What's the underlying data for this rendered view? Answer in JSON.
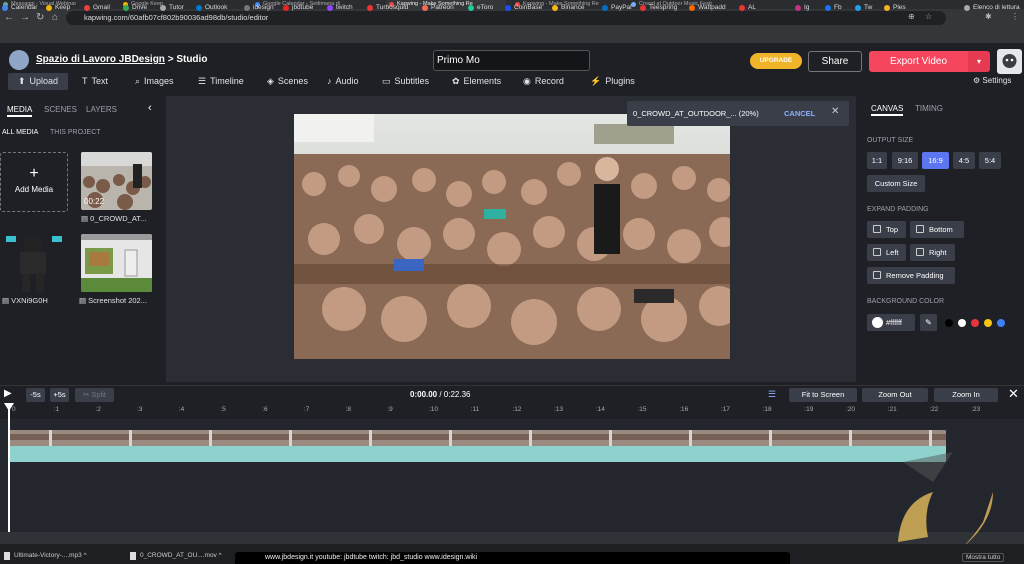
{
  "browser": {
    "tabs": [
      "Messaggi - Visual Webinar",
      "Google Keep",
      "Google Calendar - Settimana di",
      "Kapwing - Make Something Re",
      "Kapwing - Make Something Re",
      "Crowd at Outdoor Music Festi"
    ],
    "url": "kapwing.com/60afb07cf802b90036ad98db/studio/editor",
    "bookmarks": [
      "Calendar",
      "Keep",
      "Gmail",
      "Drive",
      "Tutor",
      "Outlook",
      "idesign",
      "jbdtube",
      "twitch",
      "Turbosquid",
      "Patreon",
      "eToro",
      "CoinBase",
      "Binance",
      "PayPal",
      "Teespring",
      "Wattpadd",
      "AL",
      "Ig",
      "Fb",
      "Tw",
      "Ples"
    ],
    "reading_list": "Elenco di lettura"
  },
  "header": {
    "workspace": "Spazio di Lavoro JBDesign",
    "separator": " > ",
    "studio": "Studio",
    "title_value": "Primo Mo",
    "upgrade": "UPGRADE",
    "share": "Share",
    "export": "Export Video",
    "settings": "Settings"
  },
  "toolbar": {
    "items": [
      "Upload",
      "Text",
      "Images",
      "Timeline",
      "Scenes",
      "Audio",
      "Subtitles",
      "Elements",
      "Record",
      "Plugins"
    ]
  },
  "left": {
    "tabs": [
      "MEDIA",
      "SCENES",
      "LAYERS"
    ],
    "subtabs": [
      "ALL MEDIA",
      "THIS PROJECT"
    ],
    "add_media": "Add Media",
    "media": [
      {
        "label": "0_CROWD_AT...",
        "duration": "00:22"
      },
      {
        "label": "VXNi9G0H"
      },
      {
        "label": "Screenshot 202..."
      }
    ]
  },
  "toast": {
    "text": "0_CROWD_AT_OUTDOOR_... (20%)",
    "cancel": "CANCEL"
  },
  "right": {
    "tabs": [
      "CANVAS",
      "TIMING"
    ],
    "output_size": "OUTPUT SIZE",
    "ratios": [
      "1:1",
      "9:16",
      "16:9",
      "4:5",
      "5:4"
    ],
    "selected_ratio": "16:9",
    "custom_size": "Custom Size",
    "expand_padding": "EXPAND PADDING",
    "padding": [
      "Top",
      "Bottom",
      "Left",
      "Right"
    ],
    "remove_padding": "Remove Padding",
    "background_color": "BACKGROUND COLOR",
    "bg_value": "#ffffff",
    "swatches": [
      "#000000",
      "#ffffff",
      "#e8343c",
      "#f5c518",
      "#3b82f6"
    ]
  },
  "timeline": {
    "back": "-5s",
    "forward": "+5s",
    "split": "Split",
    "current": "0:00.00",
    "total": " / 0:22.36",
    "fit": "Fit to Screen",
    "zoom_out": "Zoom Out",
    "zoom_in": "Zoom In",
    "ticks": [
      "0",
      ":1",
      ":2",
      ":3",
      ":4",
      ":5",
      ":6",
      ":7",
      ":8",
      ":9",
      ":10",
      ":11",
      ":12",
      ":13",
      ":14",
      ":15",
      ":16",
      ":17",
      ":18",
      ":19",
      ":20",
      ":21",
      ":22",
      ":23"
    ]
  },
  "downloads": {
    "files": [
      "Ultimate-Victory-....mp3",
      "0_CROWD_AT_OU....mov"
    ],
    "caption": "www.jbdesign.it     youtube: jbdtube     twitch: jbd_studio     www.idesign.wiki",
    "show_all": "Mostra tutto"
  }
}
